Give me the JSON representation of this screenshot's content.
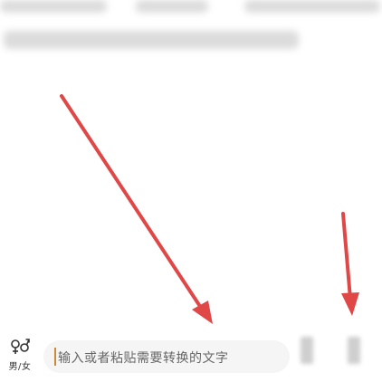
{
  "input": {
    "placeholder": "输入或者粘贴需要转换的文字"
  },
  "gender_toggle": {
    "label": "男/女",
    "icon": "gender-icon"
  },
  "actions": [
    {
      "icon": "blurred-button-icon"
    },
    {
      "icon": "blurred-button-icon"
    }
  ],
  "colors": {
    "arrow": "#e04848",
    "caret": "#c98b3a",
    "input_bg": "#f5f5f5"
  }
}
